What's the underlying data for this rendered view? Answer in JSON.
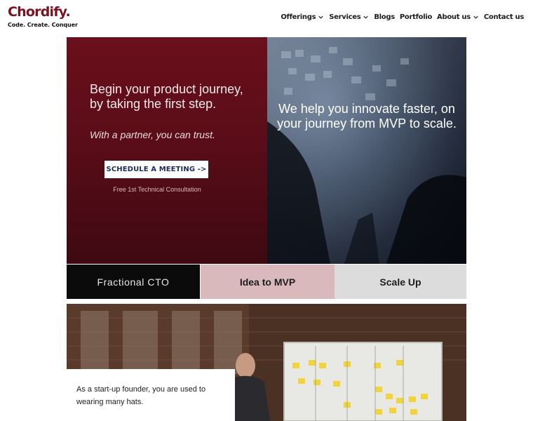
{
  "brand": {
    "name": "Chordify.",
    "tagline": "Code. Create. Conquer",
    "color": "#7a1220"
  },
  "nav": {
    "items": [
      {
        "label": "Offerings",
        "dropdown": true
      },
      {
        "label": "Services",
        "dropdown": true
      },
      {
        "label": "Blogs",
        "dropdown": false
      },
      {
        "label": "Portfolio",
        "dropdown": false
      },
      {
        "label": "About us",
        "dropdown": true
      },
      {
        "label": "Contact us",
        "dropdown": false
      }
    ]
  },
  "hero": {
    "heading": "Begin your product journey, by taking the first step.",
    "subheading": "With a partner, you can trust.",
    "cta_label": "SCHEDULE A MEETING ->",
    "cta_note": "Free 1st Technical Consultation",
    "right_text": "We help you innovate faster, on your journey from MVP to scale.",
    "colors": {
      "left_bg": "#5a0d18",
      "cta_text": "#1d2a5c"
    }
  },
  "tabs": [
    {
      "label": "Fractional CTO",
      "bg": "#0b0b0b"
    },
    {
      "label": "Idea to MVP",
      "bg": "#d9b9bc"
    },
    {
      "label": "Scale Up",
      "bg": "#dcdcdc"
    }
  ],
  "section": {
    "card_text": "As a start-up founder, you are used to wearing many hats."
  }
}
